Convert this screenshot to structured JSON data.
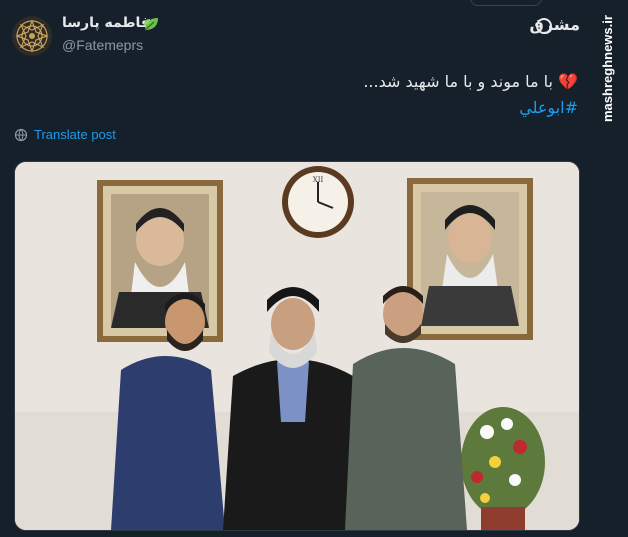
{
  "tweet": {
    "display_name": "فاطمه پارسا",
    "handle": "@Fatemeprs",
    "text": "با ما موند و با ما شهید شد...",
    "emoji": "💔",
    "hashtag": "#ابوعلي",
    "translate_label": "Translate post"
  },
  "source": {
    "logo_text": "مشرق",
    "watermark": "mashreghnews.ir"
  },
  "icons": {
    "avatar": "avatar-ornament-icon",
    "leaf": "leaf-icon",
    "translate": "globe-icon",
    "logo": "mashregh-logo-icon"
  },
  "colors": {
    "background": "#15202b",
    "link": "#1d9bf0",
    "muted": "#8b98a5",
    "text": "#e7e9ea",
    "heart": "#e0245e"
  }
}
